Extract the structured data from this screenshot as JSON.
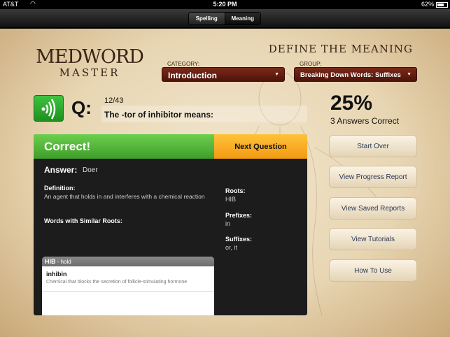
{
  "status": {
    "carrier": "AT&T",
    "time": "5:20 PM",
    "battery": "62%"
  },
  "nav": {
    "tabs": [
      {
        "label": "Spelling"
      },
      {
        "label": "Meaning"
      }
    ]
  },
  "app": {
    "logo_line1": "MEDWORD",
    "logo_line2": "MASTER",
    "title": "DEFINE THE MEANING"
  },
  "category": {
    "label": "CATEGORY:",
    "value": "Introduction"
  },
  "group": {
    "label": "GROUP:",
    "value": "Breaking Down Words: Suffixes"
  },
  "question": {
    "prefix": "Q:",
    "count": "12/43",
    "text": "The -tor of inhibitor means:"
  },
  "score": {
    "percent": "25%",
    "subtitle": "3 Answers Correct"
  },
  "result": {
    "status": "Correct!",
    "next_label": "Next Question",
    "answer_label": "Answer:",
    "answer": "Doer",
    "definition_label": "Definition:",
    "definition": "An agent that holds in and interferes with a chemical reaction",
    "similar_label": "Words with Similar Roots:",
    "roots_label": "Roots:",
    "roots": "HIB",
    "prefixes_label": "Prefixes:",
    "prefixes": "in",
    "suffixes_label": "Suffixes:",
    "suffixes": "or, it",
    "similar_group": {
      "root": "HIB",
      "meaning": " - hold"
    },
    "similar_words": [
      {
        "word": "inhibin",
        "definition": "Chemical that blocks the secretion of follicle-stimulating hormone"
      },
      {
        "word": "",
        "definition": ""
      },
      {
        "word": "",
        "definition": ""
      }
    ]
  },
  "actions": [
    {
      "label": "Start Over"
    },
    {
      "label": "View Progress Report"
    },
    {
      "label": "View Saved Reports"
    },
    {
      "label": "View Tutorials"
    },
    {
      "label": "How To Use"
    }
  ],
  "colors": {
    "accent_green": "#3f9e2a",
    "accent_orange": "#f29a12",
    "dropdown": "#6a2214"
  }
}
